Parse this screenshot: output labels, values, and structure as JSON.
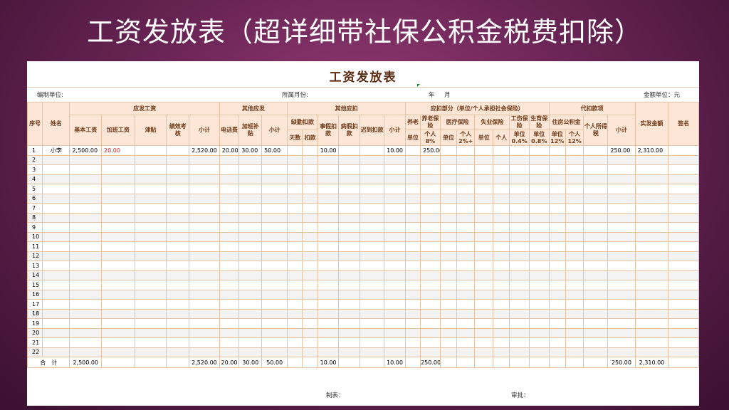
{
  "banner": "工资发放表（超详细带社保公积金税费扣除）",
  "sheet": {
    "title": "工资发放表",
    "info": {
      "unit_label": "编制单位:",
      "month_label": "所属月份:",
      "year": "年",
      "month": "月",
      "currency_label": "金额单位：元"
    },
    "headers": {
      "seq": "序号",
      "name": "姓名",
      "payable": "应发工资",
      "base": "基本工资",
      "overtime": "加班工资",
      "allowance": "津贴",
      "performance": "绩效考核",
      "subtotal": "小计",
      "other_payable": "其他应发",
      "phone": "电话费",
      "ot_subsidy": "加班补贴",
      "other_deduct": "其他应扣",
      "absence": "缺勤扣款",
      "days": "天数",
      "deduct": "扣款",
      "personal_leave": "事假扣款",
      "sick_leave": "病假扣款",
      "late": "迟到扣款",
      "insurance": "应扣部分（单位/个人承担社会保险）",
      "pension": "养老",
      "pension_personal": "养老保险",
      "medical": "医疗保险",
      "unemployment": "失业保险",
      "injury": "工伤保险",
      "maternity": "生育保险",
      "unit": "单位",
      "personal": "个人",
      "personal_8": "个人8%",
      "personal_2": "个人2%+",
      "unit_04": "单位0.4%",
      "unit_08": "单位0.8%",
      "withhold": "代扣款项",
      "housing": "住房公积金",
      "unit_12": "单位12%",
      "personal_12": "个人12%",
      "income_tax": "个人所得税",
      "net": "实发金额",
      "sign": "签名"
    },
    "rows": [
      {
        "seq": "1",
        "name": "小李",
        "base": "2,500.00",
        "overtime": "20.00",
        "subtotal1": "2,520.00",
        "phone": "20.00",
        "ot_sub": "30.00",
        "subtotal2": "50.00",
        "personal_leave": "10.00",
        "subtotal3": "10.00",
        "pension_8": "250.00",
        "subtotal4": "250.00",
        "net": "2,310.00"
      },
      {
        "seq": "2"
      },
      {
        "seq": "3"
      },
      {
        "seq": "4"
      },
      {
        "seq": "5"
      },
      {
        "seq": "6"
      },
      {
        "seq": "7"
      },
      {
        "seq": "8"
      },
      {
        "seq": "9"
      },
      {
        "seq": "10"
      },
      {
        "seq": "11"
      },
      {
        "seq": "12"
      },
      {
        "seq": "13"
      },
      {
        "seq": "14"
      },
      {
        "seq": "15"
      },
      {
        "seq": "16"
      },
      {
        "seq": "17"
      },
      {
        "seq": "18"
      },
      {
        "seq": "19"
      },
      {
        "seq": "20"
      },
      {
        "seq": "21"
      },
      {
        "seq": "22"
      }
    ],
    "totals": {
      "label": "合　计",
      "base": "2,500.00",
      "subtotal1": "2,520.00",
      "phone": "20.00",
      "ot_sub": "30.00",
      "subtotal2": "50.00",
      "personal_leave": "10.00",
      "subtotal3": "10.00",
      "pension_8": "250.00",
      "subtotal4": "250.00",
      "net": "2,310.00"
    },
    "footer": {
      "made_by": "制表：",
      "reviewed_by": "审批："
    }
  },
  "colors": {
    "header_bg": "#fde6d6",
    "border": "#e8c3a3",
    "red_text": "#d02020"
  }
}
